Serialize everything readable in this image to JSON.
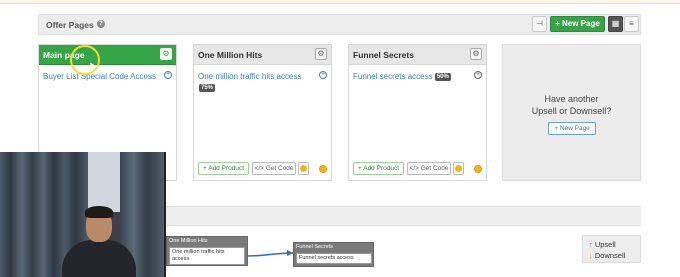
{
  "panel": {
    "title": "Offer Pages",
    "new_page_label": "+ New Page"
  },
  "cards": [
    {
      "title": "Main page",
      "link": "Buyer List Special Code Access",
      "active": true
    },
    {
      "title": "One Million Hits",
      "link": "One million traffic hits access",
      "percent": "75%",
      "add_label": "+ Add Product",
      "code_label": "</> Get Code"
    },
    {
      "title": "Funnel Secrets",
      "link": "Funnel secrets access",
      "percent": "50%",
      "add_label": "+ Add Product",
      "code_label": "</> Get Code"
    }
  ],
  "upsell": {
    "line1": "Have another",
    "line2": "Upsell or Downsell?",
    "button": "+ New Page"
  },
  "flow": {
    "node1_title": "One Million Hits",
    "node1_body": "One million traffic hits access",
    "node2_title": "Funnel Secrets",
    "node2_body": "Funnel secrets access"
  },
  "legend": {
    "upsell": "Upsell",
    "downsell": "Downsell"
  },
  "icons": {
    "help": "help-icon",
    "sitemap": "sitemap-icon",
    "grid": "grid-icon",
    "list": "list-icon",
    "gear": "gear-icon",
    "plus": "plus-circle-icon"
  },
  "colors": {
    "accent_green": "#35a547",
    "link_blue": "#3b7fc4",
    "badge_dark": "#555555"
  }
}
